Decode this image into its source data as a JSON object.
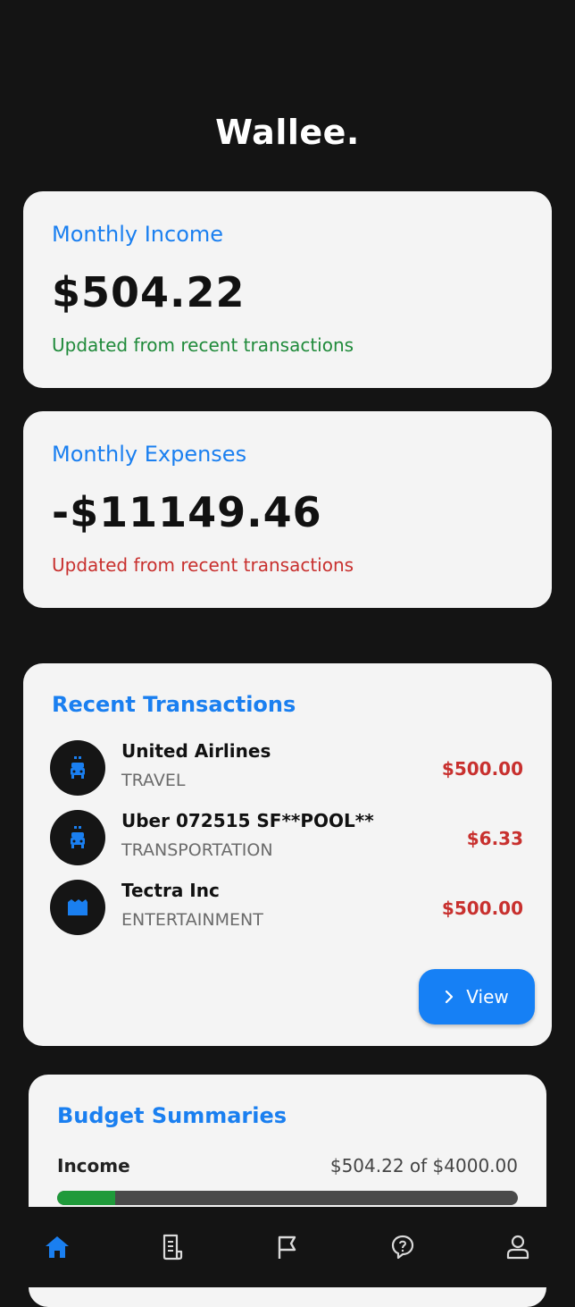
{
  "app": {
    "title": "Wallee."
  },
  "income": {
    "label": "Monthly Income",
    "amount": "$504.22",
    "note": "Updated from recent transactions"
  },
  "expenses": {
    "label": "Monthly Expenses",
    "amount": "-$11149.46",
    "note": "Updated from recent transactions"
  },
  "transactions": {
    "title": "Recent Transactions",
    "items": [
      {
        "name": "United Airlines",
        "category": "TRAVEL",
        "amount": "$500.00",
        "icon": "car-icon"
      },
      {
        "name": "Uber 072515 SF**POOL**",
        "category": "TRANSPORTATION",
        "amount": "$6.33",
        "icon": "car-icon"
      },
      {
        "name": "Tectra Inc",
        "category": "ENTERTAINMENT",
        "amount": "$500.00",
        "icon": "movie-icon"
      }
    ],
    "view_label": "View"
  },
  "budget": {
    "title": "Budget Summaries",
    "income_label": "Income",
    "income_amount": "$504.22 of $4000.00",
    "income_progress": 0.126
  },
  "colors": {
    "accent": "#1a7ff0",
    "positive": "#1f8a3a",
    "negative": "#c8302e",
    "background": "#141414",
    "card": "#f4f4f4"
  },
  "nav": {
    "items": [
      "home-icon",
      "receipt-icon",
      "flag-icon",
      "help-icon",
      "profile-icon"
    ],
    "active": "home-icon"
  }
}
